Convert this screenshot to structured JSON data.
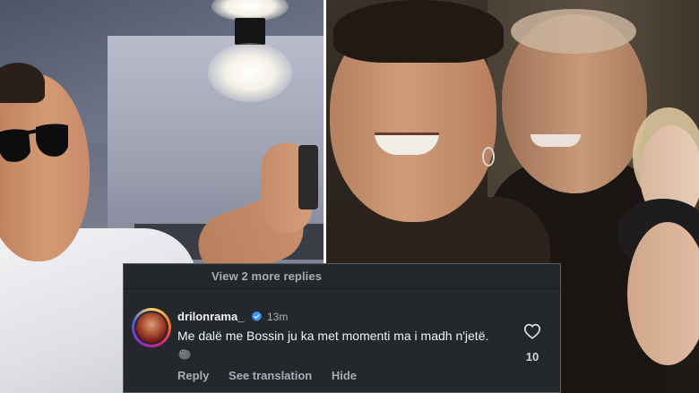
{
  "comment_thread": {
    "view_more_replies": "View 2 more replies",
    "comment": {
      "username": "drilonrama_",
      "verified": true,
      "timestamp": "13m",
      "text": "Me dalë me Bossin ju ka met momenti ma i madh n'jetë.",
      "emoji": "gorilla-emoji",
      "likes": "10"
    },
    "actions": {
      "reply": "Reply",
      "see_translation": "See translation",
      "hide": "Hide"
    }
  },
  "icons": {
    "verified": "verified-badge-icon",
    "heart": "heart-outline-icon"
  },
  "colors": {
    "card_bg": "#24272c",
    "verified_blue": "#3897f0",
    "secondary_text": "#a9adb5"
  }
}
